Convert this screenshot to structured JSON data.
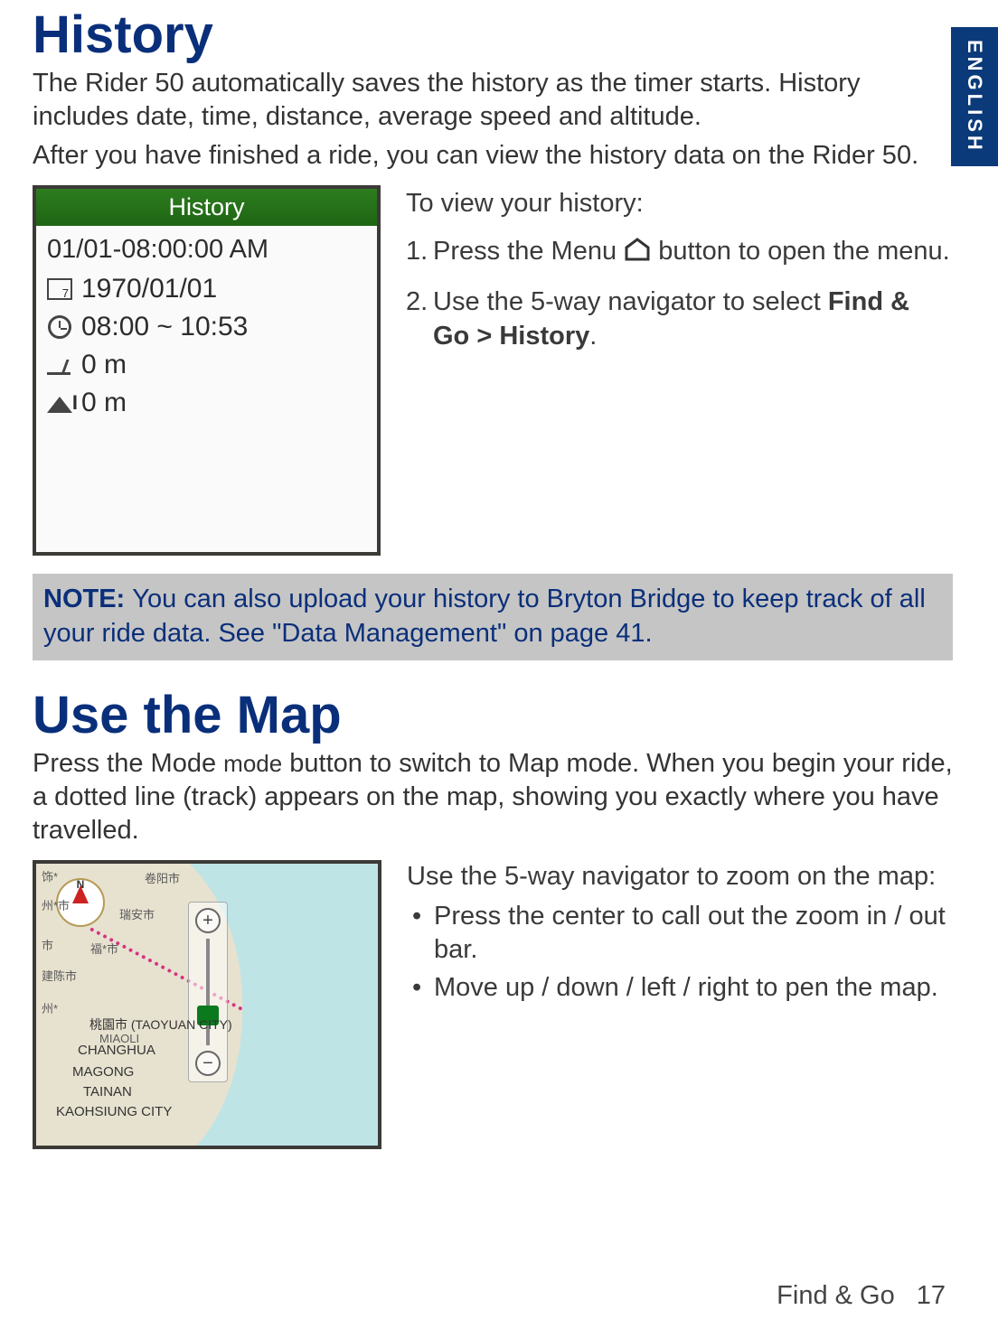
{
  "lang_tab": "ENGLISH",
  "section1": {
    "title": "History",
    "para1": "The Rider 50 automatically saves the history as the timer starts. History includes date, time, distance, average speed and altitude.",
    "para2": "After you have finished a ride, you can view the history data on the Rider 50."
  },
  "device_history": {
    "title": "History",
    "entry_title": "01/01-08:00:00 AM",
    "date": "1970/01/01",
    "time": "08:00 ~ 10:53",
    "distance": "0 m",
    "altitude": "0 m"
  },
  "steps": {
    "intro": "To view your history:",
    "step1_num": "1.",
    "step1_a": "Press the Menu ",
    "step1_b": " button to open the menu.",
    "step2_num": "2.",
    "step2_a": "Use the 5-way navigator to select ",
    "step2_bold": "Find & Go > History",
    "step2_end": "."
  },
  "note": {
    "label": "NOTE: ",
    "text": "You can also upload your history to Bryton Bridge to keep track of all your ride data. See \"Data Management\" on page 41."
  },
  "section2": {
    "title": "Use the Map",
    "para_a": "Press the Mode ",
    "mode_word": "mode",
    "para_b": " button to switch to Map mode. When you begin your ride, a dotted line (track) appears on the map, showing you exactly where you have travelled."
  },
  "map_labels": {
    "c1": "饰*",
    "c1r": "卷阳市",
    "c2": "州*市",
    "c2r": "瑞安市",
    "c3": "市",
    "c3r": "福*市",
    "c4": "建陈市",
    "c5": "州*",
    "c5b": "桃園市 (TAOYUAN CITY)",
    "c6": "CHANGHUA",
    "c7": "MAGONG",
    "c8": "TAINAN",
    "c9": "KAOHSIUNG CITY",
    "miaoli": "MIAOLI"
  },
  "map_instructions": {
    "intro": "Use the 5-way navigator to zoom on the map:",
    "b1": "Press the center to call out the zoom in / out bar.",
    "b2": "Move up / down / left / right to pen the map."
  },
  "footer": {
    "label": "Find & Go",
    "page": "17"
  }
}
